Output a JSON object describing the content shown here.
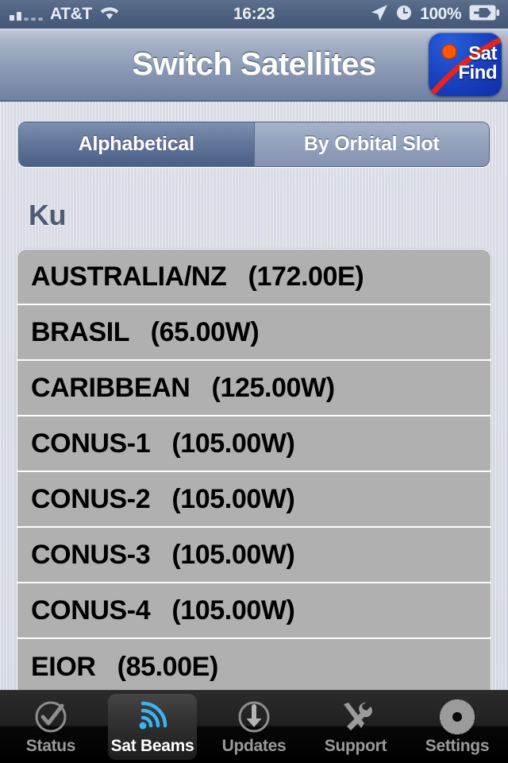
{
  "status_bar": {
    "carrier": "AT&T",
    "signal_icon": "signal-bars-icon",
    "signal_bars_filled": 2,
    "signal_bars_total": 5,
    "wifi_icon": "wifi-icon",
    "time": "16:23",
    "location_icon": "location-arrow-icon",
    "alarm_icon": "alarm-clock-icon",
    "battery_percent": "100%",
    "battery_icon": "battery-charging-icon"
  },
  "nav_bar": {
    "title": "Switch Satellites",
    "sat_find_button": {
      "name": "sat-find-button",
      "line1": "Sat",
      "line2": "Find",
      "arc_color": "#e8231a",
      "dot_color": "#ff5a00",
      "background_color": "#1b43c2"
    }
  },
  "segmented_control": {
    "options": [
      {
        "label": "Alphabetical",
        "selected": true
      },
      {
        "label": "By Orbital Slot",
        "selected": false
      }
    ]
  },
  "section": {
    "header": "Ku"
  },
  "satellite_list": {
    "rows": [
      {
        "name": "AUSTRALIA/NZ",
        "slot": "(172.00E)",
        "text": "AUSTRALIA/NZ   (172.00E)"
      },
      {
        "name": "BRASIL",
        "slot": "(65.00W)",
        "text": "BRASIL   (65.00W)"
      },
      {
        "name": "CARIBBEAN",
        "slot": "(125.00W)",
        "text": "CARIBBEAN   (125.00W)"
      },
      {
        "name": "CONUS-1",
        "slot": "(105.00W)",
        "text": "CONUS-1   (105.00W)"
      },
      {
        "name": "CONUS-2",
        "slot": "(105.00W)",
        "text": "CONUS-2   (105.00W)"
      },
      {
        "name": "CONUS-3",
        "slot": "(105.00W)",
        "text": "CONUS-3   (105.00W)"
      },
      {
        "name": "CONUS-4",
        "slot": "(105.00W)",
        "text": "CONUS-4   (105.00W)"
      },
      {
        "name": "EIOR",
        "slot": "(85.00E)",
        "text": "EIOR   (85.00E)"
      }
    ]
  },
  "tab_bar": {
    "active_color": "#3ab4f2",
    "tabs": [
      {
        "label": "Status",
        "icon": "check-circle-icon",
        "active": false
      },
      {
        "label": "Sat Beams",
        "icon": "signal-waves-icon",
        "active": true
      },
      {
        "label": "Updates",
        "icon": "download-arrow-icon",
        "active": false
      },
      {
        "label": "Support",
        "icon": "tools-icon",
        "active": false
      },
      {
        "label": "Settings",
        "icon": "gear-icon",
        "active": false
      }
    ]
  }
}
